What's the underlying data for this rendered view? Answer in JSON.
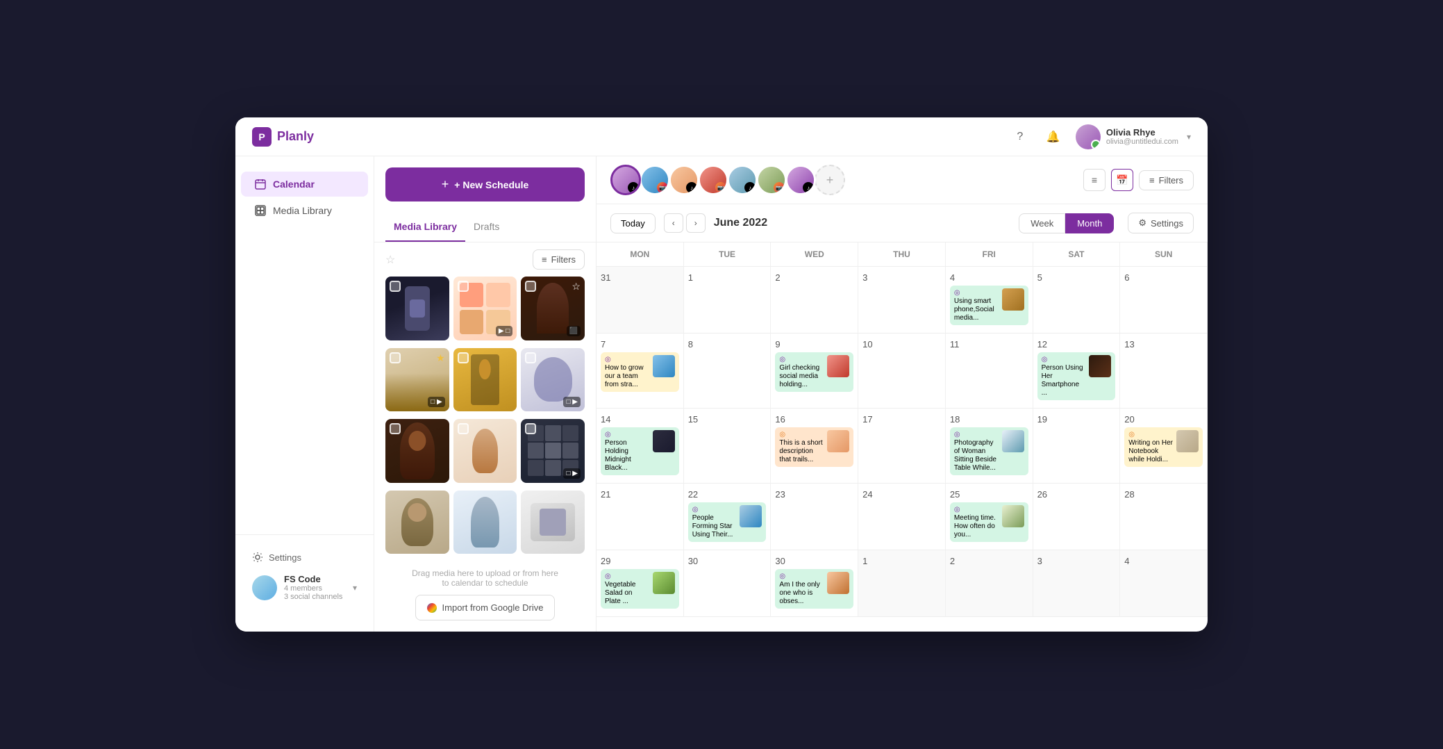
{
  "app": {
    "name": "Planly"
  },
  "topbar": {
    "user_name": "Olivia Rhye",
    "user_email": "olivia@untitledui.com"
  },
  "sidebar": {
    "items": [
      {
        "label": "Calendar",
        "id": "calendar",
        "active": true
      },
      {
        "label": "Media Library",
        "id": "media-library",
        "active": false
      }
    ],
    "settings_label": "Settings",
    "workspace": {
      "name": "FS Code",
      "members": "4 members",
      "channels": "3 social channels"
    }
  },
  "content": {
    "new_schedule_label": "+ New Schedule",
    "tabs": [
      {
        "label": "Media Library",
        "active": true
      },
      {
        "label": "Drafts",
        "active": false
      }
    ],
    "filters_label": "Filters",
    "upload_hint": "Drag media here to upload or from here\nto calendar to schedule",
    "import_label": "Import from Google Drive"
  },
  "calendar": {
    "today_label": "Today",
    "month_label": "June 2022",
    "views": [
      {
        "label": "Week",
        "active": false
      },
      {
        "label": "Month",
        "active": true
      }
    ],
    "settings_label": "Settings",
    "filters_label": "Filters",
    "days": [
      "MON",
      "TUE",
      "WED",
      "THU",
      "FRI",
      "SAT",
      "SUN"
    ],
    "events": {
      "fri4": {
        "icon": "instagram",
        "text": "Using smart phone,Social media...",
        "color": "green"
      },
      "mon7": {
        "icon": "instagram",
        "text": "How to grow our a team from stra...",
        "color": "yellow"
      },
      "wed9": {
        "icon": "instagram",
        "text": "Girl checking social media holding...",
        "color": "green"
      },
      "sat12": {
        "icon": "instagram",
        "text": "Person Using Her Smartphone ...",
        "color": "green"
      },
      "mon14": {
        "icon": "instagram",
        "text": "Person Holding Midnight Black...",
        "color": "green"
      },
      "wed16": {
        "icon": "instagram",
        "text": "This is a short description that trails...",
        "color": "orange"
      },
      "fri18": {
        "icon": "instagram",
        "text": "Photography of Woman Sitting Beside Table While...",
        "color": "green"
      },
      "sun20": {
        "icon": "instagram",
        "text": "Writing on Her Notebook while Holdi...",
        "color": "yellow"
      },
      "tue22": {
        "icon": "instagram",
        "text": "People Forming Star Using Their...",
        "color": "green"
      },
      "fri25": {
        "icon": "instagram",
        "text": "Meeting time. How often do you...",
        "color": "green"
      },
      "mon29": {
        "icon": "instagram",
        "text": "Vegetable Salad on Plate ...",
        "color": "green"
      },
      "wed30": {
        "icon": "instagram",
        "text": "Am I the only one who is obses...",
        "color": "green"
      }
    },
    "weeks": [
      {
        "cells": [
          {
            "date": "31",
            "dimmed": true
          },
          {
            "date": "1"
          },
          {
            "date": "2"
          },
          {
            "date": "3"
          },
          {
            "date": "4",
            "has_event": true,
            "event_key": "fri4"
          },
          {
            "date": "5"
          },
          {
            "date": "6"
          }
        ]
      },
      {
        "cells": [
          {
            "date": "7",
            "has_event": true,
            "event_key": "mon7"
          },
          {
            "date": "8"
          },
          {
            "date": "9",
            "has_event": true,
            "event_key": "wed9"
          },
          {
            "date": "10"
          },
          {
            "date": "11"
          },
          {
            "date": "12",
            "has_event": true,
            "event_key": "sat12"
          },
          {
            "date": "13"
          }
        ]
      },
      {
        "cells": [
          {
            "date": "14",
            "has_event": true,
            "event_key": "mon14"
          },
          {
            "date": "15"
          },
          {
            "date": "16",
            "has_event": true,
            "event_key": "wed16"
          },
          {
            "date": "17"
          },
          {
            "date": "18",
            "has_event": true,
            "event_key": "fri18"
          },
          {
            "date": "19"
          },
          {
            "date": "20",
            "has_event": true,
            "event_key": "sun20"
          }
        ]
      },
      {
        "cells": [
          {
            "date": "21"
          },
          {
            "date": "22",
            "has_event": true,
            "event_key": "tue22"
          },
          {
            "date": "23"
          },
          {
            "date": "24"
          },
          {
            "date": "25",
            "has_event": true,
            "event_key": "fri25"
          },
          {
            "date": "26"
          },
          {
            "date": "28"
          }
        ]
      },
      {
        "cells": [
          {
            "date": "29",
            "has_event": true,
            "event_key": "mon29"
          },
          {
            "date": "30"
          },
          {
            "date": "30",
            "has_event": true,
            "event_key": "wed30"
          },
          {
            "date": "1",
            "dimmed": true
          },
          {
            "date": "2",
            "dimmed": true
          },
          {
            "date": "3",
            "dimmed": true
          },
          {
            "date": "4",
            "dimmed": true
          }
        ]
      }
    ]
  }
}
